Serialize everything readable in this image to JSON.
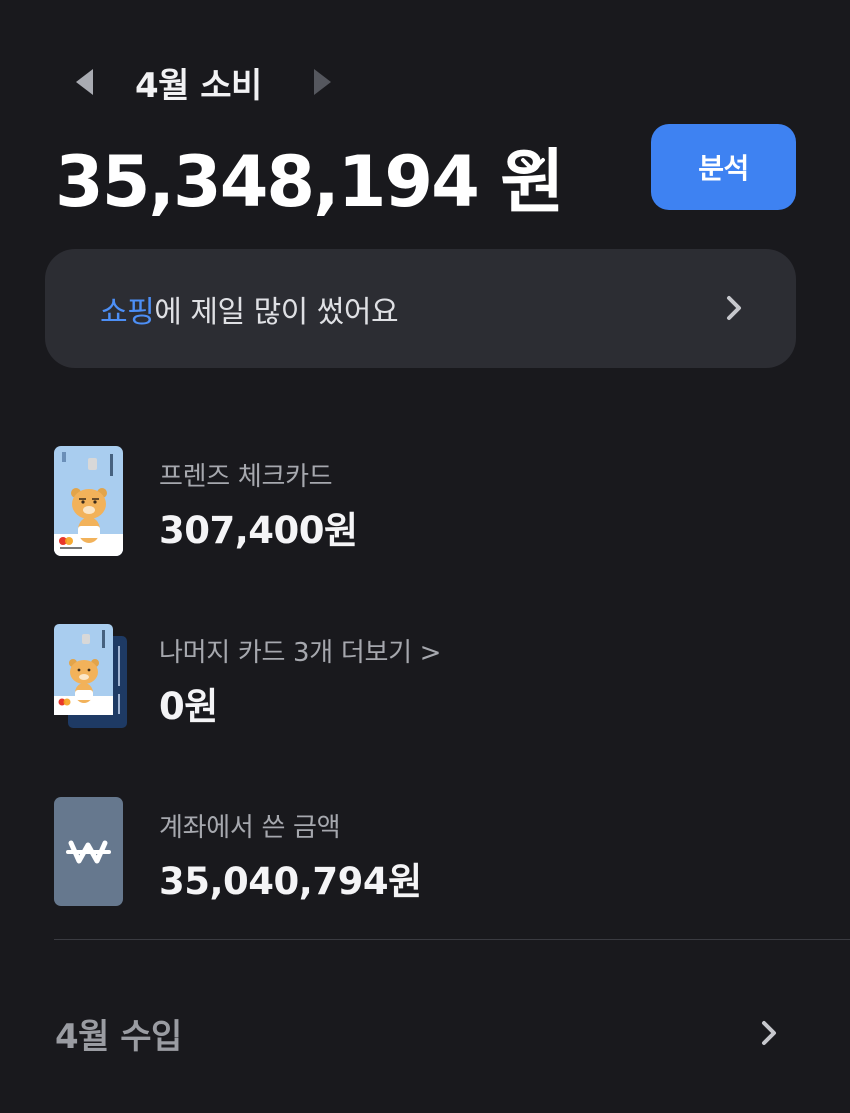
{
  "header": {
    "month_title": "4월 소비",
    "prev_icon": "triangle-left-icon",
    "next_icon": "triangle-right-icon"
  },
  "summary": {
    "total": "35,348,194 원",
    "analyze_label": "분석"
  },
  "insight": {
    "highlight": "쇼핑",
    "text": "에 제일 많이 썼어요"
  },
  "items": [
    {
      "title": "프렌즈 체크카드",
      "amount": "307,400원",
      "icon": "friends-card-icon"
    },
    {
      "title": "나머지 카드 3개 더보기 >",
      "amount": "0원",
      "icon": "card-stack-icon"
    },
    {
      "title": "계좌에서 쓴 금액",
      "amount": "35,040,794원",
      "icon": "won-account-icon"
    }
  ],
  "income": {
    "title": "4월 수입"
  },
  "colors": {
    "background": "#19191d",
    "accent": "#3e82f2",
    "highlight": "#4d8ff6",
    "banner": "#2c2d33"
  }
}
